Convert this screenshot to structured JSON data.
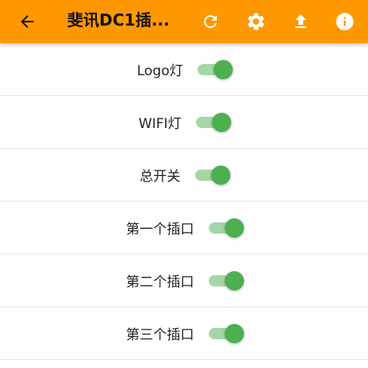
{
  "appbar": {
    "title": "斐讯DC1插...",
    "back_icon": "arrow-back-icon",
    "actions": [
      "refresh-icon",
      "settings-icon",
      "upload-icon",
      "info-icon"
    ],
    "background_color": "#ff9800"
  },
  "switches": [
    {
      "label": "Logo灯",
      "on": true
    },
    {
      "label": "WIFI灯",
      "on": true
    },
    {
      "label": "总开关",
      "on": true
    },
    {
      "label": "第一个插口",
      "on": true
    },
    {
      "label": "第二个插口",
      "on": true
    },
    {
      "label": "第三个插口",
      "on": true
    }
  ],
  "colors": {
    "switch_thumb_on": "#4caf50",
    "switch_track_on": "#a5d6a7"
  }
}
